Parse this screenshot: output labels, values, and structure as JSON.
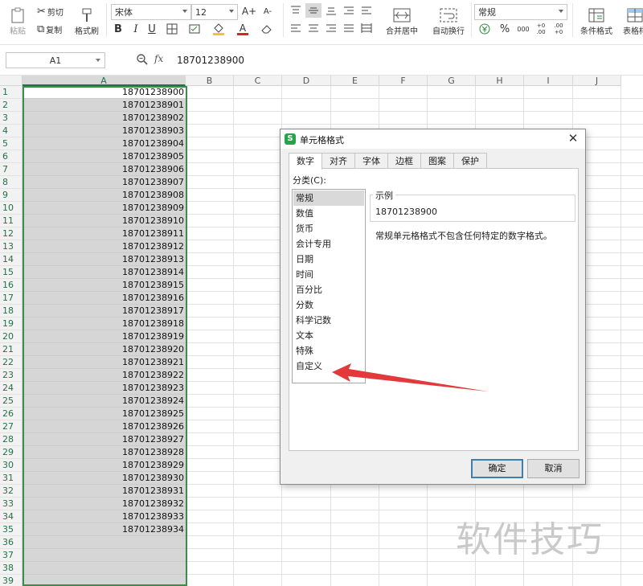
{
  "ribbon": {
    "paste_label": "粘贴",
    "cut_label": "剪切",
    "copy_label": "复制",
    "format_painter_label": "格式刷",
    "font_name": "宋体",
    "font_size": "12",
    "merge_center_label": "合并居中",
    "wrap_text_label": "自动换行",
    "number_format": "常规",
    "conditional_format_label": "条件格式",
    "table_style_label": "表格样",
    "percent_glyph": "%",
    "thousands_glyph": "000",
    "inc_decimal_glyph": "+0 .00",
    "dec_decimal_glyph": ".00 +0",
    "bold_glyph": "B",
    "italic_glyph": "I",
    "underline_glyph": "U",
    "grow_font_glyph": "A+",
    "shrink_font_glyph": "A-",
    "font_color_glyph": "A"
  },
  "formula_bar": {
    "name_box": "A1",
    "fx_label": "fx",
    "value": "18701238900"
  },
  "sheet": {
    "columns": [
      "A",
      "B",
      "C",
      "D",
      "E",
      "F",
      "G",
      "H",
      "I",
      "J"
    ],
    "rows": [
      "1",
      "2",
      "3",
      "4",
      "5",
      "6",
      "7",
      "8",
      "9",
      "10",
      "11",
      "12",
      "13",
      "14",
      "15",
      "16",
      "17",
      "18",
      "19",
      "20",
      "21",
      "22",
      "23",
      "24",
      "25",
      "26",
      "27",
      "28",
      "29",
      "30",
      "31",
      "32",
      "33",
      "34",
      "35",
      "36",
      "37",
      "38",
      "39"
    ],
    "col_a_values": [
      "18701238900",
      "18701238901",
      "18701238902",
      "18701238903",
      "18701238904",
      "18701238905",
      "18701238906",
      "18701238907",
      "18701238908",
      "18701238909",
      "18701238910",
      "18701238911",
      "18701238912",
      "18701238913",
      "18701238914",
      "18701238915",
      "18701238916",
      "18701238917",
      "18701238918",
      "18701238919",
      "18701238920",
      "18701238921",
      "18701238922",
      "18701238923",
      "18701238924",
      "18701238925",
      "18701238926",
      "18701238927",
      "18701238928",
      "18701238929",
      "18701238930",
      "18701238931",
      "18701238932",
      "18701238933",
      "18701238934",
      "",
      "",
      "",
      ""
    ],
    "selection_color": "#3b8e4a"
  },
  "dialog": {
    "title": "单元格格式",
    "logo_letter": "S",
    "close_glyph": "✕",
    "tabs": [
      "数字",
      "对齐",
      "字体",
      "边框",
      "图案",
      "保护"
    ],
    "active_tab": "数字",
    "category_label": "分类(C):",
    "categories": [
      "常规",
      "数值",
      "货币",
      "会计专用",
      "日期",
      "时间",
      "百分比",
      "分数",
      "科学记数",
      "文本",
      "特殊",
      "自定义"
    ],
    "selected_category": "常规",
    "sample_legend": "示例",
    "sample_value": "18701238900",
    "description": "常规单元格格式不包含任何特定的数字格式。",
    "ok_label": "确定",
    "cancel_label": "取消"
  },
  "annotation": {
    "arrow_color": "#e23a3a",
    "watermark": "软件技巧"
  }
}
